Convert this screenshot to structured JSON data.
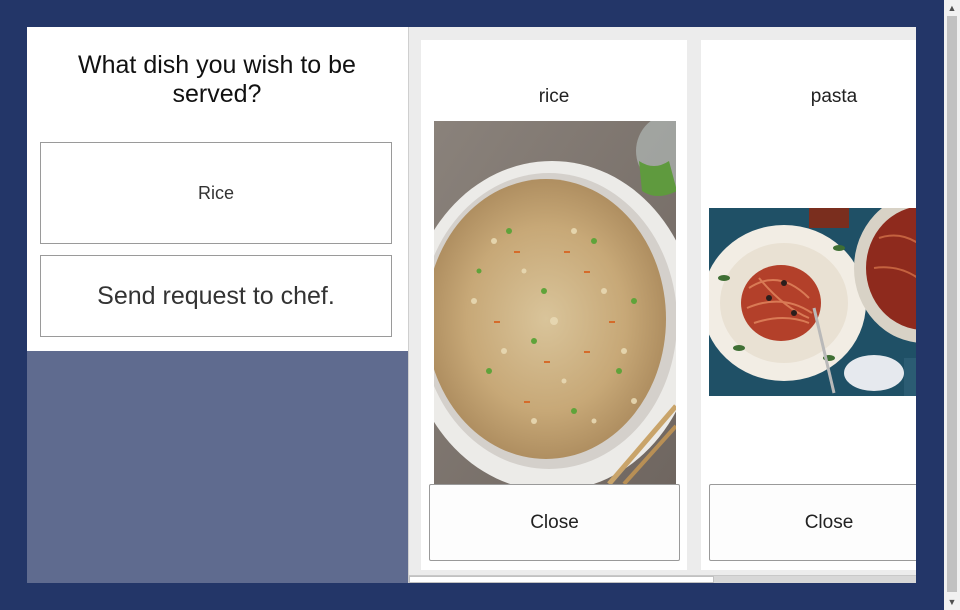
{
  "question": "What dish you wish to be served?",
  "options": {
    "selected_label": "Rice"
  },
  "send_button": "Send request to chef.",
  "cards": [
    {
      "title": "rice",
      "image": "fried-rice-bowl-photo",
      "close_label": "Close"
    },
    {
      "title": "pasta",
      "image": "spaghetti-plate-photo",
      "close_label": "Close"
    }
  ],
  "scrollbar": {
    "up_arrow": "▲",
    "down_arrow": "▼"
  }
}
